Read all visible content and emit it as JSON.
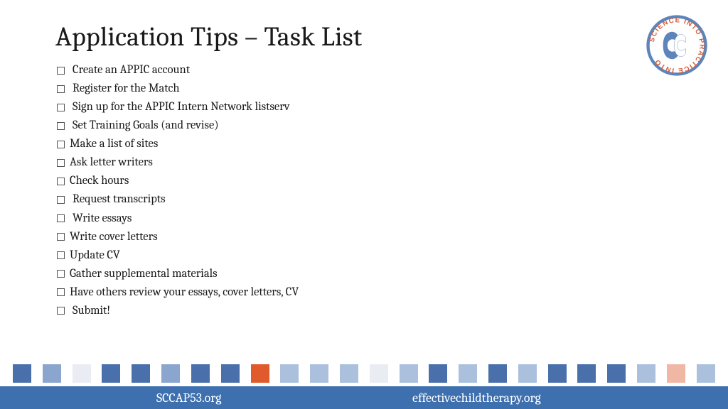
{
  "title": "Application Tips – Task List",
  "tasks": [
    "Create an APPIC account",
    "Register for the Match",
    "Sign up for the APPIC Intern Network listserv",
    "Set Training Goals (and revise)",
    "Make a list of sites",
    "Ask letter writers",
    "Check hours",
    "Request transcripts",
    "Write essays",
    "Write cover letters",
    "Update CV",
    "Gather supplemental materials",
    "Have others review your essays, cover letters, CV",
    "Submit!"
  ],
  "logo": {
    "outer_text": "SCIENCE INTO PRACTICE INTO",
    "ring_color": "#5d84bb",
    "text_color": "#d25c3b",
    "head_blue": "#5d84bb",
    "head_white": "#ffffff"
  },
  "square_colors": [
    "#4a70ac",
    "#8aa6cf",
    "#e9edf3",
    "#4a70ac",
    "#4a70ac",
    "#8aa6cf",
    "#4a70ac",
    "#4a70ac",
    "#e05a2b",
    "#aac0dd",
    "#aac0dd",
    "#aac0dd",
    "#e9edf3",
    "#aac0dd",
    "#4a70ac",
    "#aac0dd",
    "#4a70ac",
    "#aac0dd",
    "#4a70ac",
    "#4a70ac",
    "#4a70ac",
    "#aac0dd",
    "#f0b7a5",
    "#aac0dd"
  ],
  "footer": {
    "left": "SCCAP53.org",
    "right": "effectivechildtherapy.org",
    "bg": "#3e6fae"
  }
}
